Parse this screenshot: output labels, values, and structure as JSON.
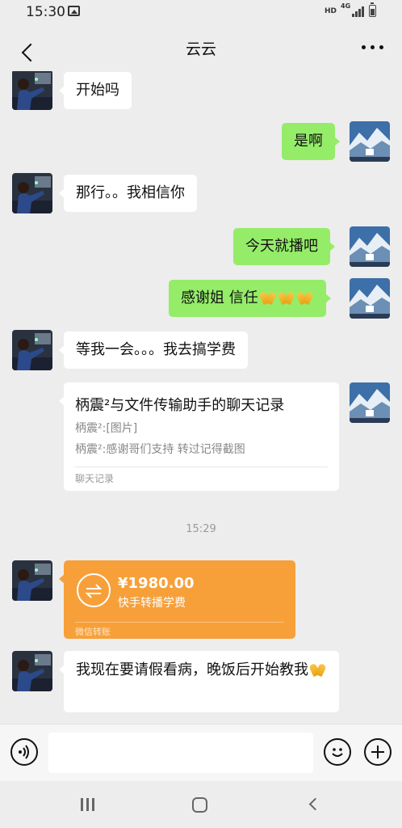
{
  "status_bar": {
    "time": "15:30",
    "network_hd": "HD",
    "network_4g": "4G"
  },
  "header": {
    "title": "云云"
  },
  "messages": [
    {
      "side": "left",
      "text": "开始吗"
    },
    {
      "side": "right",
      "text": "是啊"
    },
    {
      "side": "left",
      "text": "那行。。我相信你"
    },
    {
      "side": "right",
      "text": "今天就播吧"
    },
    {
      "side": "right",
      "text": "感谢姐 信任",
      "emojis": 3
    },
    {
      "side": "left",
      "text": "等我一会。。。我去搞学费"
    }
  ],
  "chat_record": {
    "title": "柄震²与文件传输助手的聊天记录",
    "line1": "柄震²:[图片]",
    "line2": "柄震²:感谢哥们支持 转过记得截图",
    "footer": "聊天记录"
  },
  "timestamp": "15:29",
  "transfer": {
    "amount": "¥1980.00",
    "note": "快手转播学费",
    "label": "微信转账",
    "color": "#f7a03a"
  },
  "last_message": {
    "text": "我现在要请假看病，晚饭后开始教我"
  },
  "input": {
    "value": "",
    "placeholder": ""
  },
  "colors": {
    "background": "#ededed",
    "sent_bubble": "#95ec69",
    "received_bubble": "#ffffff"
  }
}
